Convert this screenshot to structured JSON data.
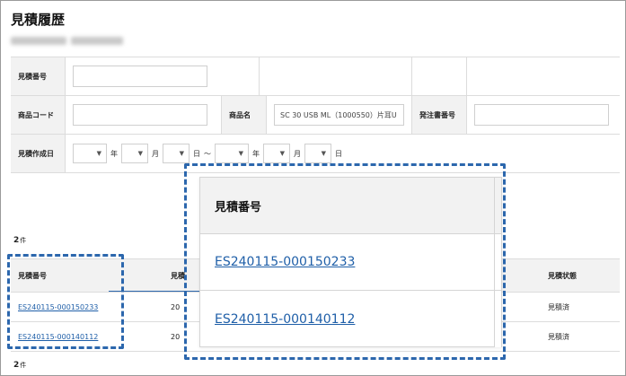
{
  "page": {
    "title": "見積履歴"
  },
  "form": {
    "quote_number_label": "見積番号",
    "product_code_label": "商品コード",
    "product_name_label": "商品名",
    "product_name_value": "SC 30 USB ML（1000550）片耳U",
    "order_number_label": "発注書番号",
    "quote_date_label": "見積作成日",
    "year_unit": "年",
    "month_unit": "月",
    "day_unit": "日",
    "range_sep": "〜"
  },
  "results": {
    "count_top": "2",
    "count_bottom": "2",
    "count_unit": "件",
    "headers": {
      "quote_number": "見積番号",
      "col2": "見積",
      "status": "見積状態"
    },
    "rows": [
      {
        "quote_number": "ES240115-000150233",
        "col2": "20",
        "status": "見積済"
      },
      {
        "quote_number": "ES240115-000140112",
        "col2": "20",
        "status": "見積済"
      }
    ]
  },
  "zoom": {
    "header": "見積番号",
    "rows": [
      "ES240115-000150233",
      "ES240115-000140112"
    ]
  },
  "colors": {
    "highlight": "#2c67ad",
    "link": "#1f5fa8",
    "header_bg": "#f2f2f2"
  }
}
